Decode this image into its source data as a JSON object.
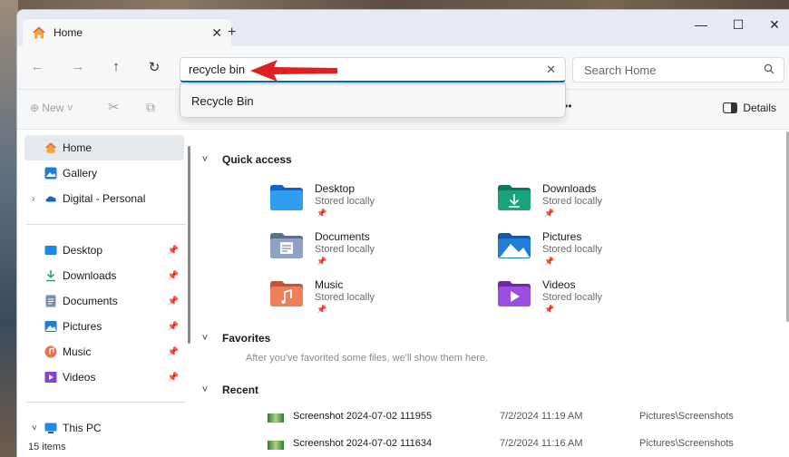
{
  "tab": {
    "title": "Home",
    "close": "✕",
    "new": "+"
  },
  "window_controls": {
    "minimize": "—",
    "maximize": "☐",
    "close": "✕"
  },
  "nav": {
    "back": "←",
    "forward": "→",
    "up": "↑",
    "refresh": "↻"
  },
  "address": {
    "value": "recycle bin",
    "clear": "✕"
  },
  "search": {
    "placeholder": "Search Home"
  },
  "suggestion": {
    "label": "Recycle Bin"
  },
  "command_bar": {
    "new_label": "New",
    "details_label": "Details",
    "more": "•••"
  },
  "sidebar": {
    "top": [
      {
        "label": "Home",
        "icon": "home-icon"
      },
      {
        "label": "Gallery",
        "icon": "gallery-icon"
      },
      {
        "label": "Digital - Personal",
        "icon": "onedrive-icon"
      }
    ],
    "pinned": [
      {
        "label": "Desktop",
        "icon": "desktop-icon"
      },
      {
        "label": "Downloads",
        "icon": "download-icon"
      },
      {
        "label": "Documents",
        "icon": "documents-icon"
      },
      {
        "label": "Pictures",
        "icon": "pictures-icon"
      },
      {
        "label": "Music",
        "icon": "music-icon"
      },
      {
        "label": "Videos",
        "icon": "videos-icon"
      }
    ],
    "this_pc": "This PC"
  },
  "main": {
    "quick_access": "Quick access",
    "folders": [
      {
        "name": "Desktop",
        "sub": "Stored locally",
        "color": "#1e88e5"
      },
      {
        "name": "Downloads",
        "sub": "Stored locally",
        "color": "#1aa37a"
      },
      {
        "name": "Documents",
        "sub": "Stored locally",
        "color": "#7a8fb0"
      },
      {
        "name": "Pictures",
        "sub": "Stored locally",
        "color": "#1f7fd6"
      },
      {
        "name": "Music",
        "sub": "Stored locally",
        "color": "#e8734a"
      },
      {
        "name": "Videos",
        "sub": "Stored locally",
        "color": "#8e3fd0"
      }
    ],
    "favorites": "Favorites",
    "favorites_empty": "After you've favorited some files, we'll show them here.",
    "recent": "Recent",
    "recent_items": [
      {
        "name": "Screenshot 2024-07-02 111955",
        "date": "7/2/2024 11:19 AM",
        "location": "Pictures\\Screenshots"
      },
      {
        "name": "Screenshot 2024-07-02 111634",
        "date": "7/2/2024 11:16 AM",
        "location": "Pictures\\Screenshots"
      }
    ]
  },
  "status": {
    "items": "15 items"
  },
  "colors": {
    "accent": "#0067c0",
    "annotation_arrow": "#e02020"
  }
}
